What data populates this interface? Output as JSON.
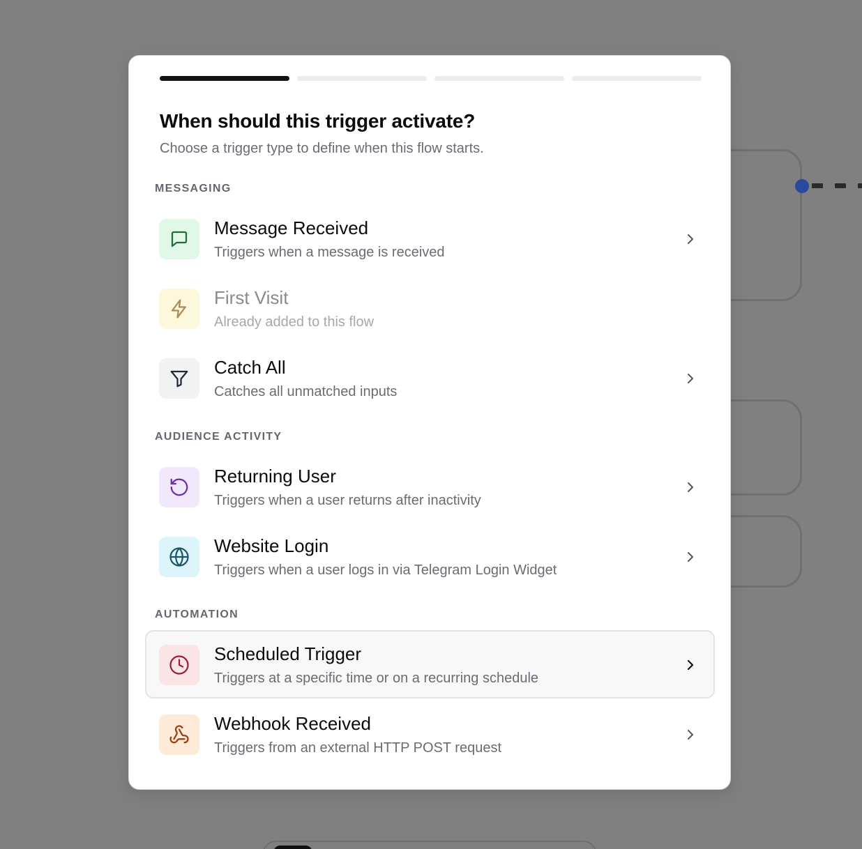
{
  "colors": {
    "overlay": "#808080",
    "progress_active": "#111111",
    "progress_inactive": "#ececec",
    "message_icon_bg": "#e1f8e8",
    "message_icon": "#1f6e3a",
    "first_visit_icon_bg": "#fdf8dc",
    "first_visit_icon": "#a88c5a",
    "catch_all_icon_bg": "#f1f2f4",
    "catch_all_icon": "#1f2937",
    "returning_icon_bg": "#f1e8fc",
    "returning_icon": "#6b2fa8",
    "website_icon_bg": "#dcf5fa",
    "website_icon": "#1e5568",
    "scheduled_icon_bg": "#fbe4e6",
    "scheduled_icon": "#98203a",
    "webhook_icon_bg": "#fdebd8",
    "webhook_icon": "#9a3b14"
  },
  "wizard": {
    "steps_total": 4,
    "current_step": 1
  },
  "dialog": {
    "title": "When should this trigger activate?",
    "subtitle": "Choose a trigger type to define when this flow starts."
  },
  "sections": [
    {
      "label": "MESSAGING",
      "items": [
        {
          "name": "Message Received",
          "description": "Triggers when a message is received",
          "icon": "message-square-icon",
          "enabled": true
        },
        {
          "name": "First Visit",
          "description": "Already added to this flow",
          "icon": "lightning-icon",
          "enabled": false
        },
        {
          "name": "Catch All",
          "description": "Catches all unmatched inputs",
          "icon": "funnel-icon",
          "enabled": true
        }
      ]
    },
    {
      "label": "AUDIENCE ACTIVITY",
      "items": [
        {
          "name": "Returning User",
          "description": "Triggers when a user returns after inactivity",
          "icon": "rotate-ccw-icon",
          "enabled": true
        },
        {
          "name": "Website Login",
          "description": "Triggers when a user logs in via Telegram Login Widget",
          "icon": "globe-icon",
          "enabled": true
        }
      ]
    },
    {
      "label": "AUTOMATION",
      "items": [
        {
          "name": "Scheduled Trigger",
          "description": "Triggers at a specific time or on a recurring schedule",
          "icon": "clock-icon",
          "enabled": true,
          "hovered": true
        },
        {
          "name": "Webhook Received",
          "description": "Triggers from an external HTTP POST request",
          "icon": "webhook-icon",
          "enabled": true
        }
      ]
    }
  ]
}
